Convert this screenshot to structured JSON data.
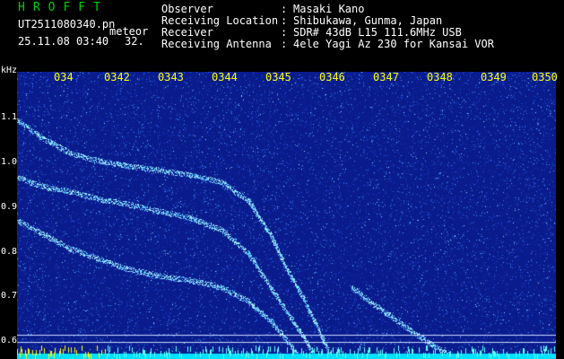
{
  "header": {
    "logo": "HROFFT",
    "filename": "UT2511080340.pn",
    "tag": "meteor",
    "datetime": "25.11.08 03:40",
    "number": "32.",
    "fields": [
      {
        "key": "Observer",
        "sep": ":",
        "value": "Masaki Kano"
      },
      {
        "key": "Receiving Location",
        "sep": ":",
        "value": "Shibukawa, Gunma, Japan"
      },
      {
        "key": "Receiver",
        "sep": ":",
        "value": "SDR# 43dB L15 111.6MHz USB"
      },
      {
        "key": "Receiving Antenna",
        "sep": ":",
        "value": "4ele Yagi Az 230 for Kansai VOR"
      }
    ]
  },
  "axis": {
    "unit": "kHz",
    "y_labels": [
      "1.1",
      "1.0",
      "0.9",
      "0.8",
      "0.7",
      "0.6"
    ],
    "y_range": [
      0.57,
      1.17
    ],
    "x_labels": [
      "034",
      "0342",
      "0343",
      "0344",
      "0345",
      "0346",
      "0347",
      "0348",
      "0349",
      "0350"
    ]
  },
  "colors": {
    "logo": "#00d000",
    "x_labels": "#ffff00",
    "background": "#0a1c8c",
    "trace": "#b0f0ff"
  },
  "spectrogram": {
    "x_range_min": [
      0,
      10
    ],
    "traces": [
      {
        "freq_khz": [
          [
            0,
            1.07
          ],
          [
            0.5,
            1.03
          ],
          [
            1.0,
            1.0
          ],
          [
            1.5,
            0.985
          ],
          [
            2.0,
            0.975
          ],
          [
            2.6,
            0.965
          ],
          [
            3.2,
            0.955
          ],
          [
            3.8,
            0.94
          ],
          [
            4.3,
            0.9
          ],
          [
            4.7,
            0.83
          ],
          [
            5.0,
            0.76
          ],
          [
            5.3,
            0.7
          ],
          [
            5.6,
            0.63
          ],
          [
            5.8,
            0.58
          ]
        ]
      },
      {
        "freq_khz": [
          [
            0,
            0.95
          ],
          [
            0.5,
            0.93
          ],
          [
            1.0,
            0.92
          ],
          [
            1.5,
            0.905
          ],
          [
            2.0,
            0.895
          ],
          [
            2.6,
            0.88
          ],
          [
            3.2,
            0.865
          ],
          [
            3.8,
            0.84
          ],
          [
            4.3,
            0.79
          ],
          [
            4.7,
            0.72
          ],
          [
            5.0,
            0.67
          ],
          [
            5.3,
            0.62
          ],
          [
            5.5,
            0.58
          ]
        ]
      },
      {
        "freq_khz": [
          [
            0,
            0.86
          ],
          [
            0.5,
            0.83
          ],
          [
            1.0,
            0.8
          ],
          [
            1.5,
            0.78
          ],
          [
            2.0,
            0.76
          ],
          [
            2.6,
            0.745
          ],
          [
            3.2,
            0.735
          ],
          [
            3.8,
            0.72
          ],
          [
            4.3,
            0.69
          ],
          [
            4.7,
            0.65
          ],
          [
            5.0,
            0.61
          ],
          [
            5.2,
            0.58
          ]
        ]
      },
      {
        "freq_khz": [
          [
            6.2,
            0.72
          ],
          [
            6.8,
            0.67
          ],
          [
            7.3,
            0.63
          ],
          [
            7.7,
            0.6
          ],
          [
            8.0,
            0.58
          ]
        ]
      }
    ]
  }
}
